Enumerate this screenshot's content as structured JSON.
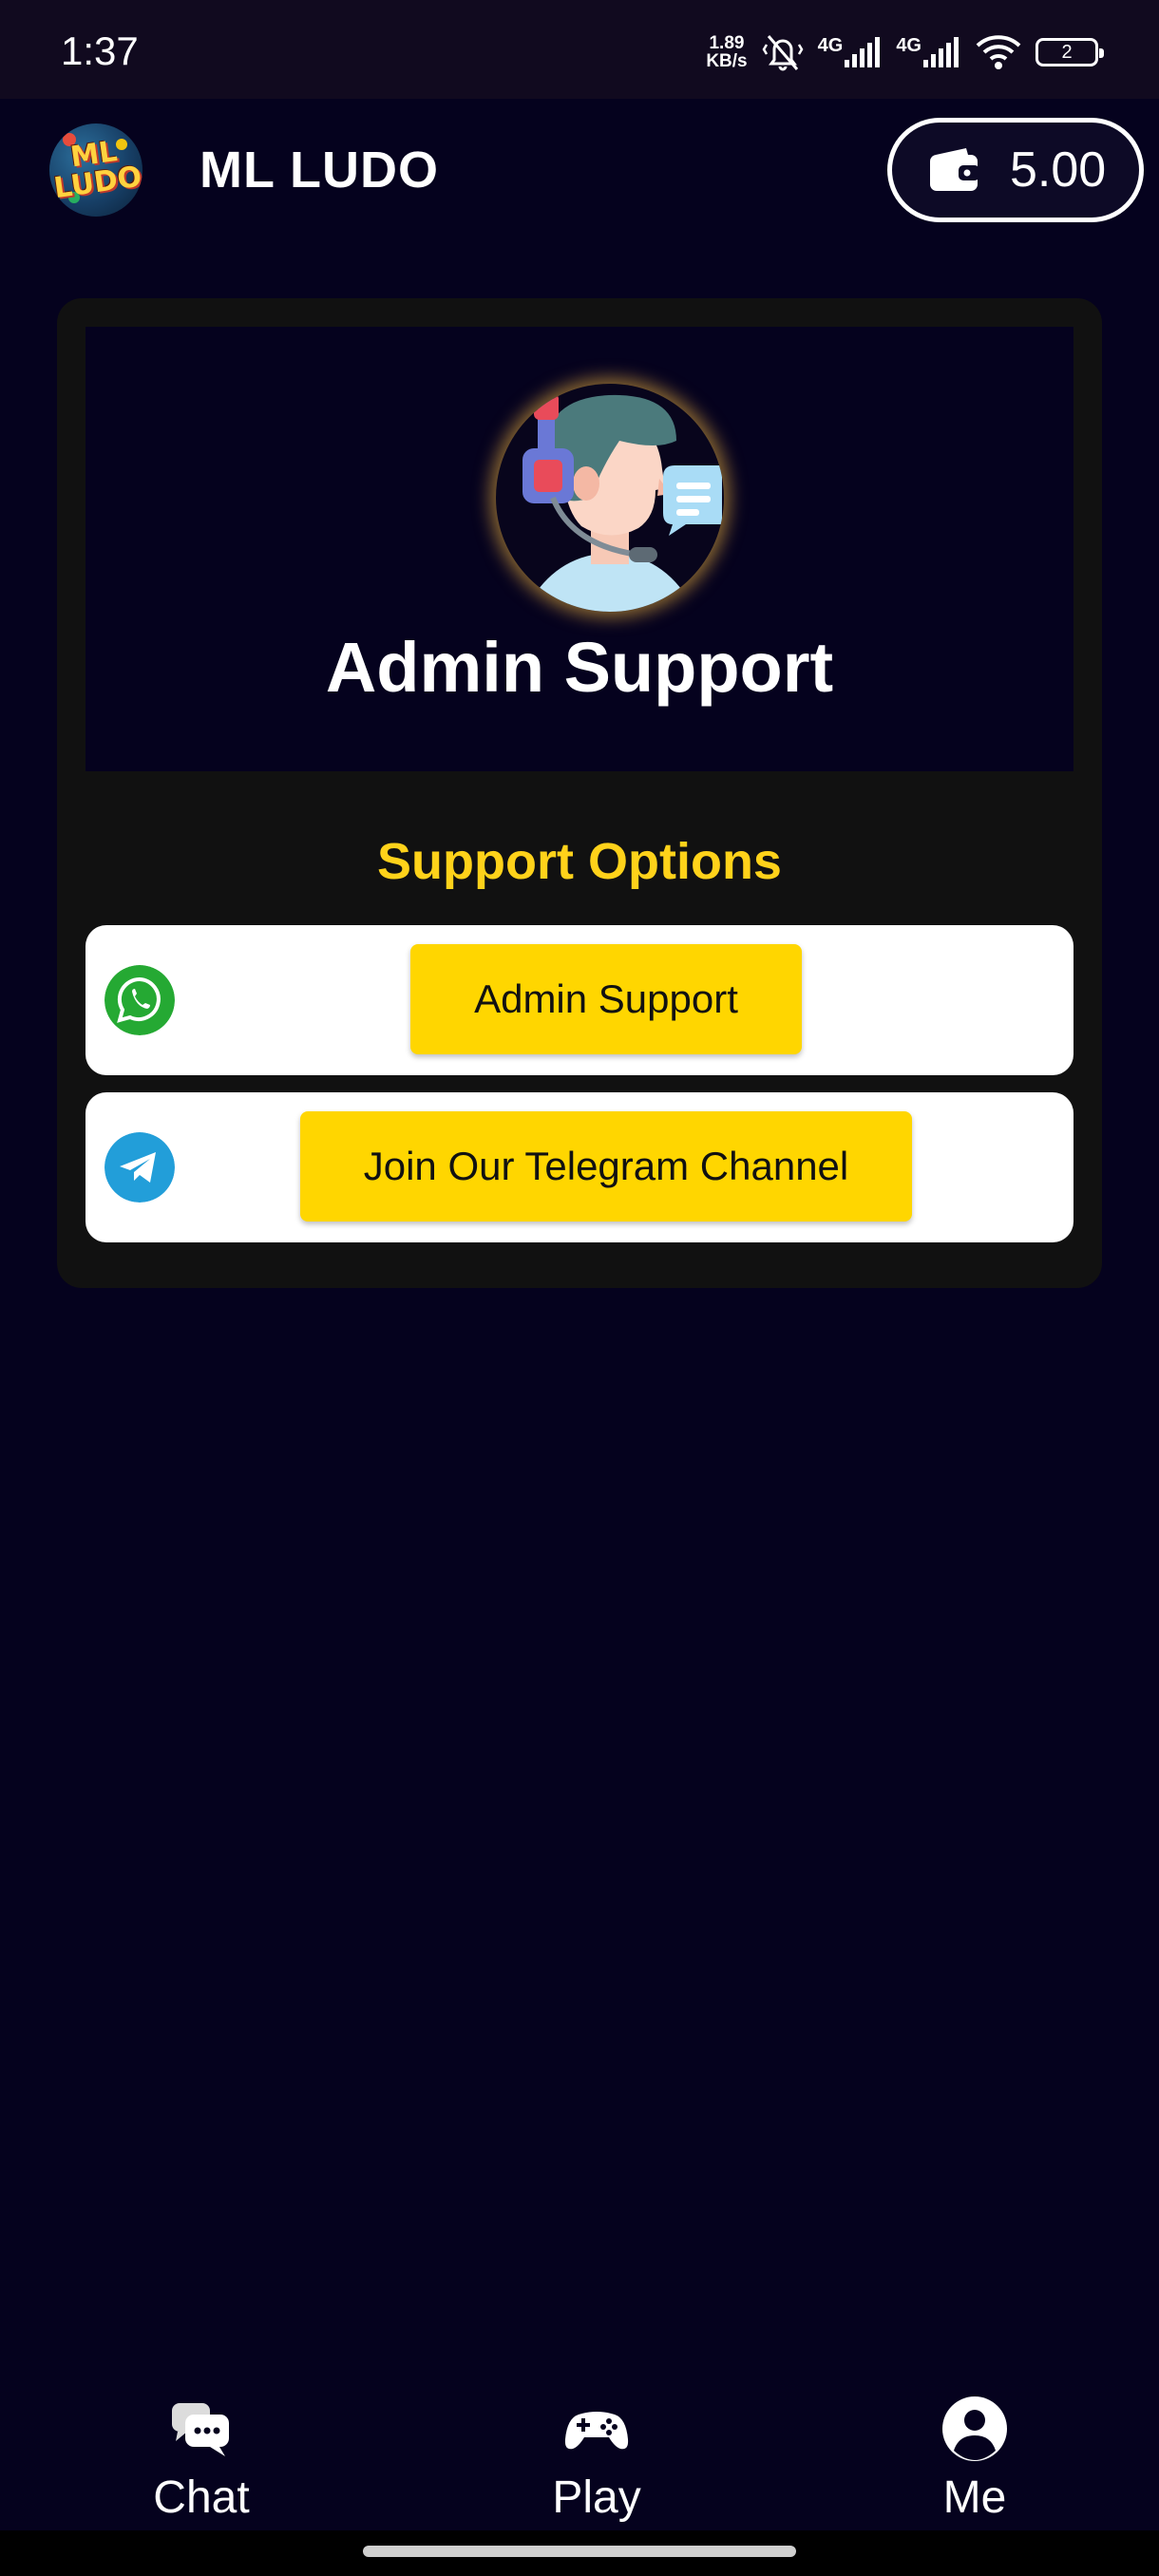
{
  "status_bar": {
    "time": "1:37",
    "net_speed_value": "1.89",
    "net_speed_unit": "KB/s",
    "sim1_label": "4G",
    "sim2_label": "4G",
    "battery": "2"
  },
  "header": {
    "logo_line1": "ML",
    "logo_line2": "LUDO",
    "title": "ML LUDO",
    "wallet_balance": "5.00"
  },
  "hero": {
    "title": "Admin Support"
  },
  "support": {
    "section_title": "Support Options",
    "options": [
      {
        "icon": "whatsapp-icon",
        "icon_color": "#25a933",
        "label": "Admin Support"
      },
      {
        "icon": "telegram-icon",
        "icon_color": "#229ed9",
        "label": "Join Our Telegram Channel"
      }
    ]
  },
  "bottom_nav": {
    "items": [
      {
        "icon": "chat-icon",
        "label": "Chat"
      },
      {
        "icon": "gamepad-icon",
        "label": "Play"
      },
      {
        "icon": "profile-icon",
        "label": "Me"
      }
    ]
  },
  "colors": {
    "background": "#05021e",
    "card": "#111111",
    "accent_yellow": "#ffd600",
    "section_title": "#ffd21a"
  }
}
